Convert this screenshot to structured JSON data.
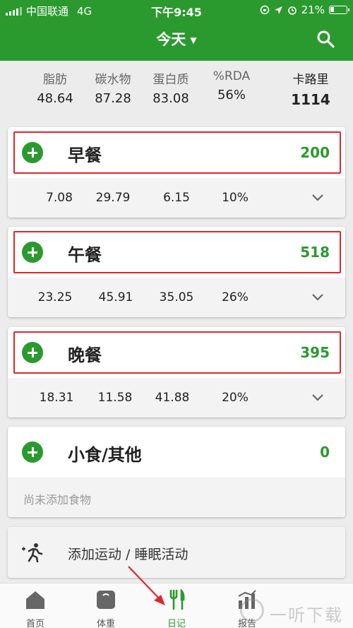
{
  "status_bar": {
    "carrier": "中国联通",
    "network": "4G",
    "time": "下午9:45",
    "battery": "21%"
  },
  "header": {
    "title": "今天",
    "caret": "▼"
  },
  "summary": {
    "fat": {
      "label": "脂肪",
      "value": "48.64"
    },
    "carbs": {
      "label": "碳水物",
      "value": "87.28"
    },
    "protein": {
      "label": "蛋白质",
      "value": "83.08"
    },
    "rda": {
      "label": "%RDA",
      "value": "56%"
    },
    "calories": {
      "label": "卡路里",
      "value": "1114"
    }
  },
  "meals": [
    {
      "name": "早餐",
      "calories": "200",
      "fat": "7.08",
      "carbs": "29.79",
      "protein": "6.15",
      "rda": "10%"
    },
    {
      "name": "午餐",
      "calories": "518",
      "fat": "23.25",
      "carbs": "45.91",
      "protein": "35.05",
      "rda": "26%"
    },
    {
      "name": "晚餐",
      "calories": "395",
      "fat": "18.31",
      "carbs": "11.58",
      "protein": "41.88",
      "rda": "20%"
    }
  ],
  "snacks": {
    "name": "小食/其他",
    "calories": "0",
    "empty_text": "尚未添加食物"
  },
  "activity": {
    "label": "添加运动 / 睡眠活动"
  },
  "tabs": [
    {
      "label": "首页",
      "icon": "home-icon"
    },
    {
      "label": "体重",
      "icon": "scale-icon"
    },
    {
      "label": "日记",
      "icon": "fork-knife-icon"
    },
    {
      "label": "报告",
      "icon": "report-icon"
    }
  ],
  "watermark": "一听下载",
  "colors": {
    "brand_green": "#2a9a2e",
    "highlight_red": "#e0252e"
  }
}
